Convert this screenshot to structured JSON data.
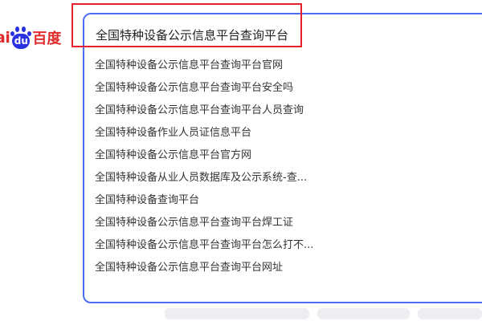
{
  "logo": {
    "left_text": "ai",
    "paw_text": "du",
    "right_text": "百度"
  },
  "search": {
    "query": "全国特种设备公示信息平台查询平台",
    "suggestions": [
      "全国特种设备公示信息平台查询平台官网",
      "全国特种设备公示信息平台查询平台安全吗",
      "全国特种设备公示信息平台查询平台人员查询",
      "全国特种设备作业人员证信息平台",
      "全国特种设备公示信息平台官方网",
      "全国特种设备从业人员数据库及公示系统-查...",
      "全国特种设备查询平台",
      "全国特种设备公示信息平台查询平台焊工证",
      "全国特种设备公示信息平台查询平台怎么打不...",
      "全国特种设备公示信息平台查询平台网址"
    ]
  },
  "colors": {
    "accent": "#4e6ef2",
    "highlight": "#e5222c",
    "brand_red": "#e02c2c",
    "brand_blue": "#2932e1"
  }
}
